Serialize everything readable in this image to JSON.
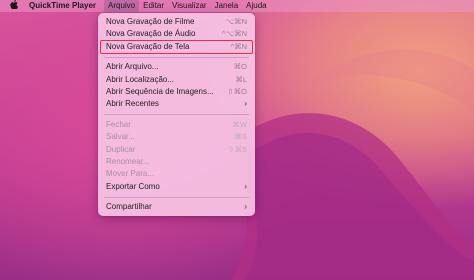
{
  "menubar": {
    "apple_icon": "apple-logo-icon",
    "app_name": "QuickTime Player",
    "menus": [
      "Arquivo",
      "Editar",
      "Visualizar",
      "Janela",
      "Ajuda"
    ],
    "active_menu": "Arquivo"
  },
  "file_menu": {
    "groups": [
      [
        {
          "label": "Nova Gravação de Filme",
          "shortcut": "⌥⌘N"
        },
        {
          "label": "Nova Gravação de Áudio",
          "shortcut": "^⌥⌘N"
        },
        {
          "label": "Nova Gravação de Tela",
          "shortcut": "^⌘N",
          "highlighted": true
        }
      ],
      [
        {
          "label": "Abrir Arquivo...",
          "shortcut": "⌘O"
        },
        {
          "label": "Abrir Localização...",
          "shortcut": "⌘L"
        },
        {
          "label": "Abrir Sequência de Imagens...",
          "shortcut": "⇧⌘O"
        },
        {
          "label": "Abrir Recentes",
          "submenu": true
        }
      ],
      [
        {
          "label": "Fechar",
          "shortcut": "⌘W",
          "disabled": true
        },
        {
          "label": "Salvar...",
          "shortcut": "⌘S",
          "disabled": true
        },
        {
          "label": "Duplicar",
          "shortcut": "⇧⌘S",
          "disabled": true
        },
        {
          "label": "Renomear...",
          "disabled": true
        },
        {
          "label": "Mover Para...",
          "disabled": true
        },
        {
          "label": "Exportar Como",
          "submenu": true
        }
      ],
      [
        {
          "label": "Compartilhar",
          "submenu": true
        }
      ]
    ],
    "submenu_glyph": "›"
  },
  "colors": {
    "highlight_outline": "#e0304a",
    "wallpaper_primary": "#c8388f",
    "wallpaper_glow": "#f3a07e"
  }
}
